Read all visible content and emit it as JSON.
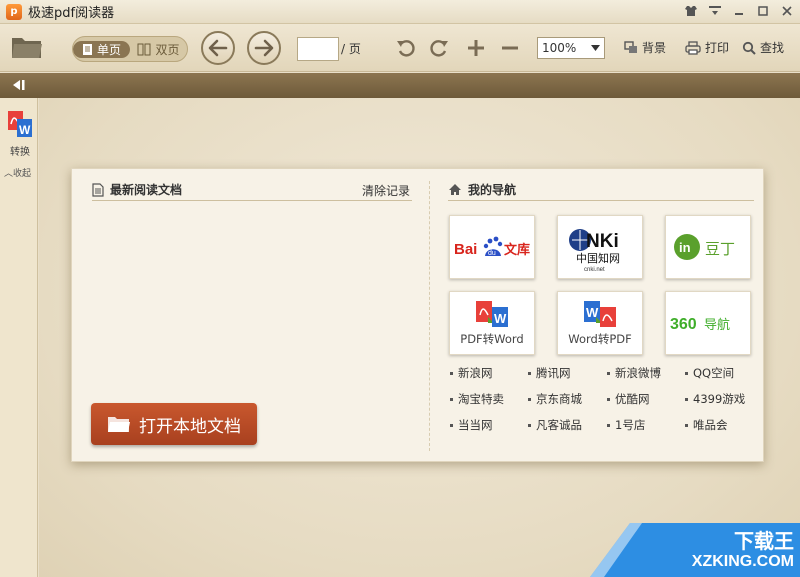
{
  "window": {
    "title": "极速pdf阅读器"
  },
  "toolbar": {
    "single_page": "单页",
    "double_page": "双页",
    "page_value": "",
    "page_suffix": "/ 页",
    "zoom": "100%",
    "background": "背景",
    "print": "打印",
    "search": "查找"
  },
  "sidebar": {
    "convert_label": "转换",
    "fold_label": "︿收起"
  },
  "recent": {
    "title": "最新阅读文档",
    "clear": "清除记录",
    "open_button": "打开本地文档"
  },
  "navigation": {
    "title": "我的导航",
    "tiles": [
      {
        "label": "Baidu文库",
        "caption": ""
      },
      {
        "label": "CNKI 中国知网",
        "caption": ""
      },
      {
        "label": "豆丁",
        "caption": ""
      },
      {
        "label": "PDF转Word",
        "caption": "PDF转Word"
      },
      {
        "label": "Word转PDF",
        "caption": "Word转PDF"
      },
      {
        "label": "360导航",
        "caption": ""
      }
    ],
    "links": [
      [
        "新浪网",
        "腾讯网",
        "新浪微博",
        "QQ空间"
      ],
      [
        "淘宝特卖",
        "京东商城",
        "优酷网",
        "4399游戏"
      ],
      [
        "当当网",
        "凡客诚品",
        "1号店",
        "唯品会"
      ]
    ]
  },
  "watermark": {
    "title": "下载王",
    "url": "XZKING.COM"
  },
  "colors": {
    "accent_button": "#b84a24",
    "strip": "#7c6644",
    "background": "#e9dfc9"
  }
}
